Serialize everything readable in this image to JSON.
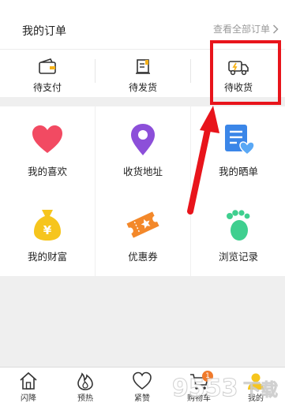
{
  "orders": {
    "title": "我的订单",
    "view_all": "查看全部订单",
    "items": [
      {
        "label": "待支付",
        "icon": "wallet-icon"
      },
      {
        "label": "待发货",
        "icon": "package-list-icon"
      },
      {
        "label": "待收货",
        "icon": "delivery-truck-icon"
      }
    ]
  },
  "grid": {
    "items": [
      {
        "label": "我的喜欢",
        "icon": "heart-icon",
        "color": "#f24a62"
      },
      {
        "label": "收货地址",
        "icon": "location-pin-icon",
        "color": "#8c4fd9"
      },
      {
        "label": "我的晒单",
        "icon": "document-heart-icon",
        "color": "#3b86e8"
      },
      {
        "label": "我的财富",
        "icon": "money-bag-icon",
        "color": "#f6c51d"
      },
      {
        "label": "优惠券",
        "icon": "coupon-ticket-icon",
        "color": "#f3882a"
      },
      {
        "label": "浏览记录",
        "icon": "footprints-icon",
        "color": "#3fcf8f"
      }
    ]
  },
  "tabbar": {
    "items": [
      {
        "label": "闪降",
        "icon": "home-icon"
      },
      {
        "label": "预热",
        "icon": "flame-icon"
      },
      {
        "label": "紧赞",
        "icon": "heart-outline-icon"
      },
      {
        "label": "购物车",
        "icon": "cart-icon",
        "badge": "1"
      },
      {
        "label": "我的",
        "icon": "user-icon"
      }
    ]
  },
  "annotation": {
    "highlight_color": "#e8141b"
  },
  "watermark": {
    "text": "9553下载"
  }
}
